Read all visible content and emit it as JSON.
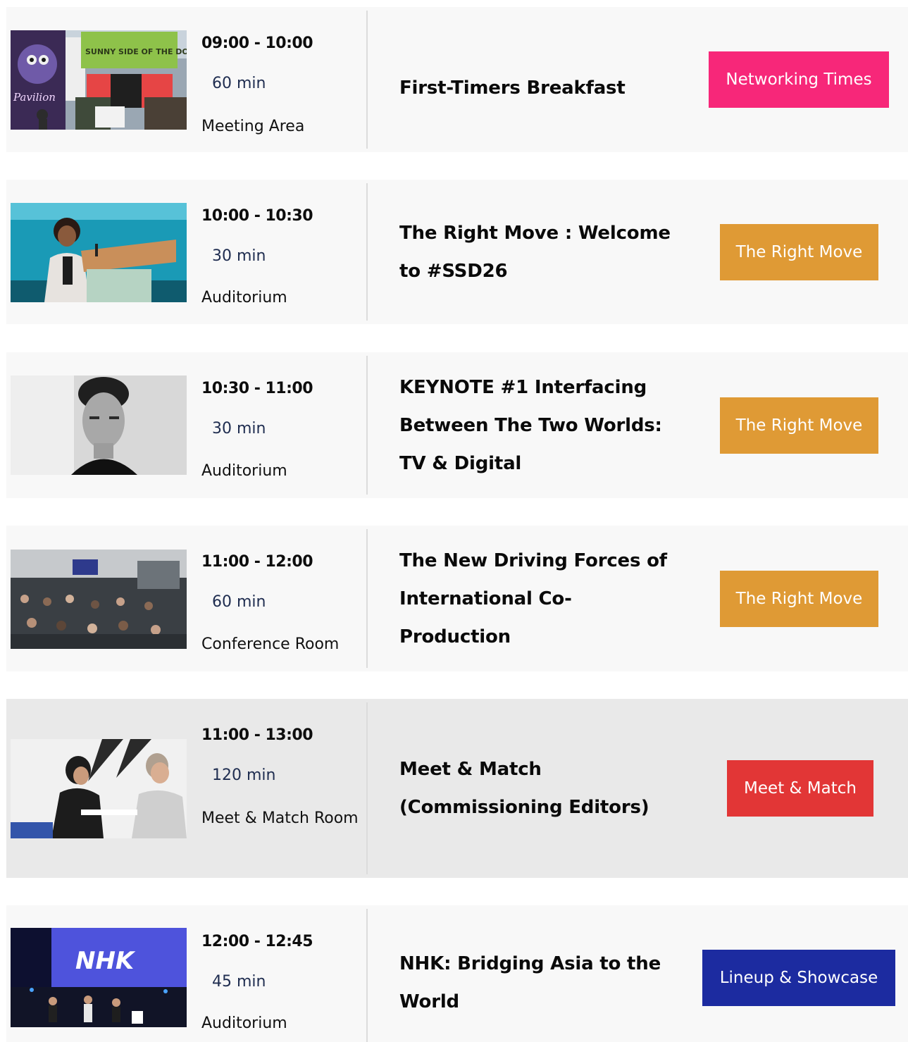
{
  "sessions": [
    {
      "time": "09:00 - 10:00",
      "duration": "60 min",
      "room": "Meeting Area",
      "title": "First-Timers Breakfast",
      "tag": {
        "label": "Networking Times",
        "color": "#f72779"
      },
      "image": {
        "subject": "photo-festival-entrance",
        "banner_text": "SUNNY SIDE OF THE DOC",
        "side_text": "Pavilion"
      }
    },
    {
      "time": "10:00 - 10:30",
      "duration": "30 min",
      "room": "Auditorium",
      "title": "The Right Move : Welcome to #SSD26",
      "tag": {
        "label": "The Right Move",
        "color": "#df9a35"
      },
      "image": {
        "subject": "photo-speaker-at-podium"
      }
    },
    {
      "time": "10:30 - 11:00",
      "duration": "30 min",
      "room": "Auditorium",
      "title": "KEYNOTE #1 Interfacing Between The Two Worlds: TV & Digital",
      "tag": {
        "label": "The Right Move",
        "color": "#df9a35"
      },
      "image": {
        "subject": "photo-portrait-bw"
      }
    },
    {
      "time": "11:00 - 12:00",
      "duration": "60 min",
      "room": "Conference Room",
      "title": "The New Driving Forces of International Co-Production",
      "tag": {
        "label": "The Right Move",
        "color": "#df9a35"
      },
      "image": {
        "subject": "photo-conference-audience"
      }
    },
    {
      "time": "11:00 - 13:00",
      "duration": "120 min",
      "room": "Meet & Match Room",
      "title": "Meet & Match (Commissioning Editors)",
      "tag": {
        "label": "Meet & Match",
        "color": "#e23636"
      },
      "image": {
        "subject": "photo-meeting-conversation"
      }
    },
    {
      "time": "12:00 - 12:45",
      "duration": "45 min",
      "room": "Auditorium",
      "title": "NHK: Bridging Asia to the World",
      "tag": {
        "label": "Lineup & Showcase",
        "color": "#1c2ba0"
      },
      "image": {
        "subject": "photo-stage-panel",
        "screen_text": "NHK"
      }
    }
  ]
}
